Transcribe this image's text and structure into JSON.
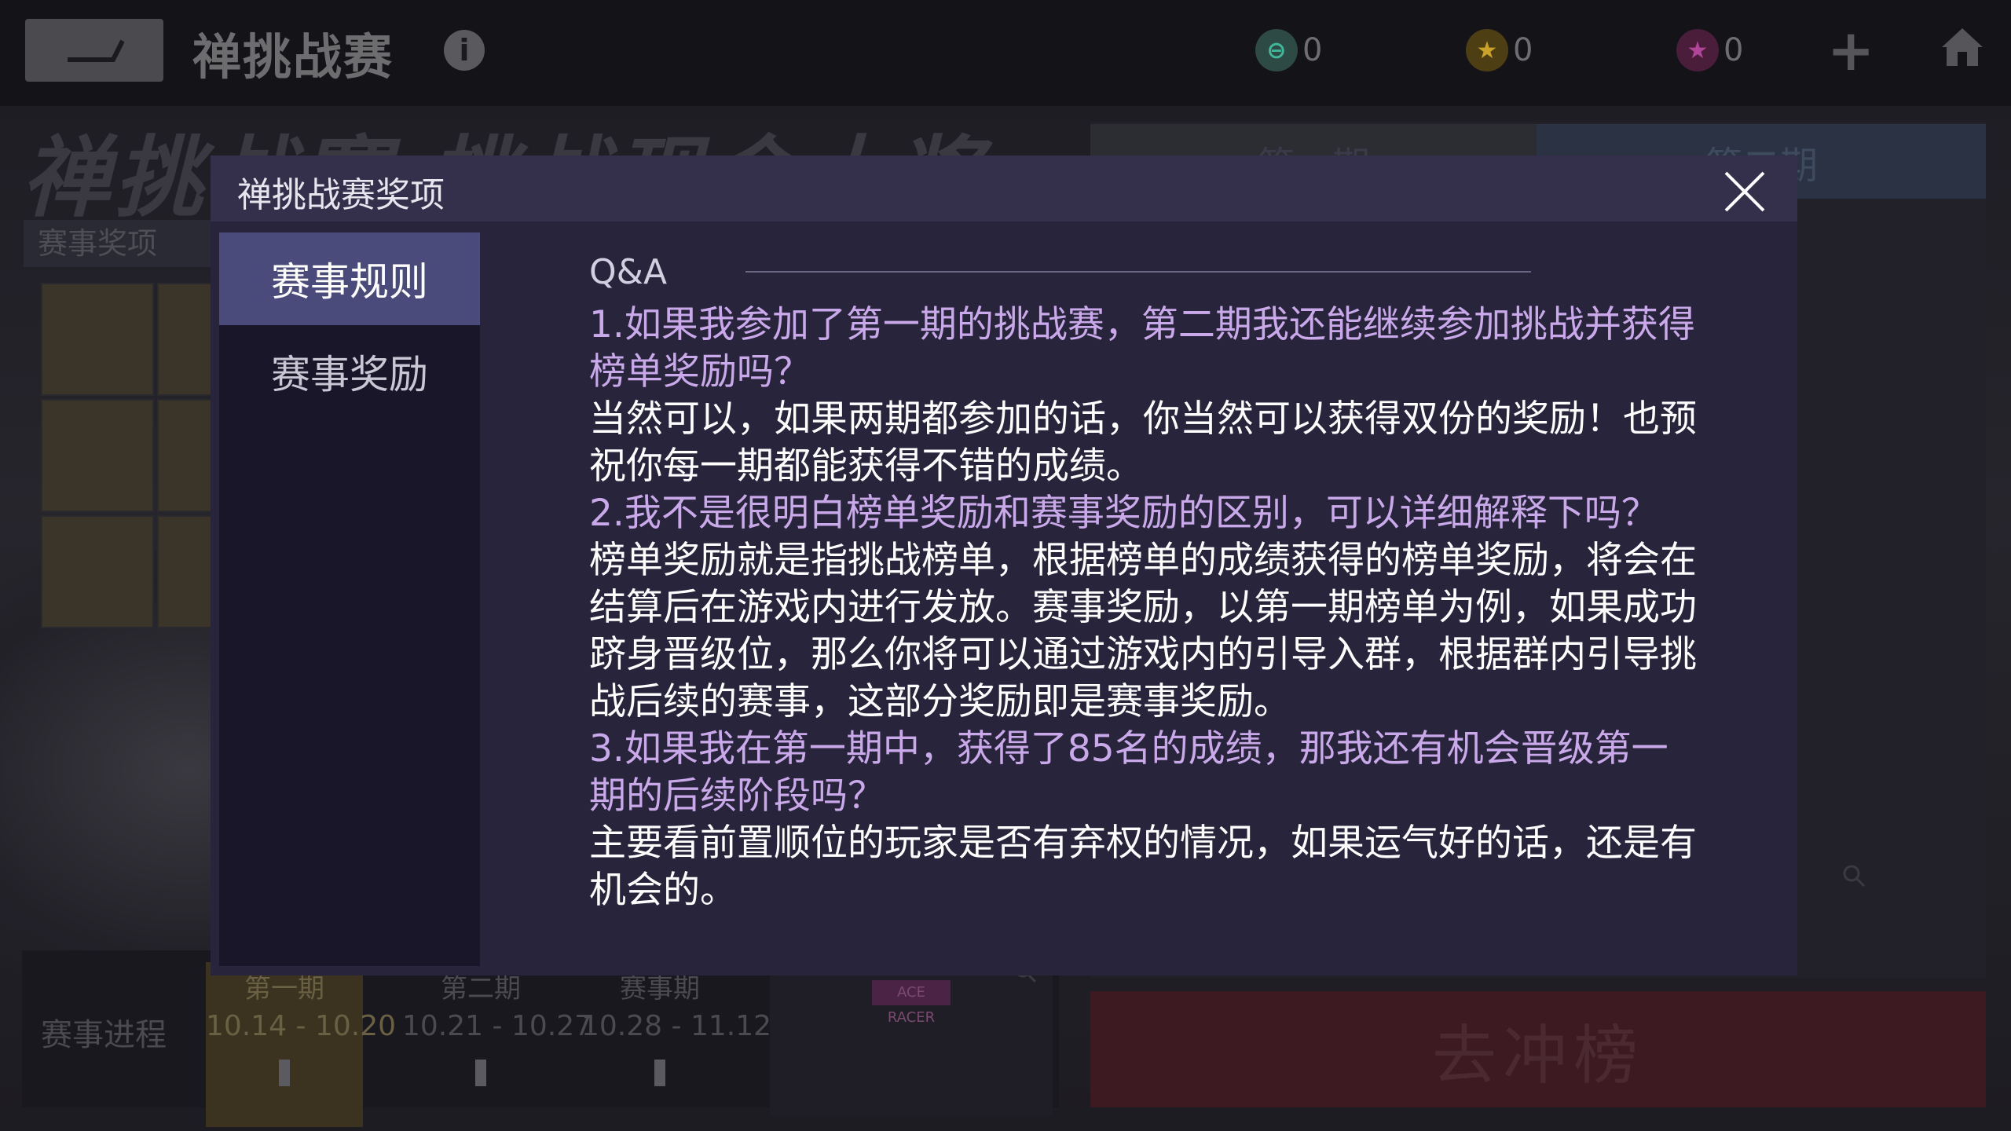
{
  "background": {
    "page_title": "禅挑战赛",
    "banner_text": "禅挑战赛 挑战现金大奖",
    "awards_label": "赛事奖项",
    "period_tabs": [
      "第一期",
      "第二期"
    ],
    "currencies": [
      {
        "icon": "ticket-icon",
        "value": "0",
        "color": "#3a8f7a"
      },
      {
        "icon": "gold-star-coin-icon",
        "value": "0",
        "color": "#b38a1e"
      },
      {
        "icon": "purple-star-coin-icon",
        "value": "0",
        "color": "#8a2e6a"
      }
    ],
    "progress": {
      "label": "赛事进程",
      "stages": [
        {
          "name": "第一期",
          "dates": "10.14 - 10.20",
          "active": true
        },
        {
          "name": "第二期",
          "dates": "10.21 - 10.27",
          "active": false
        },
        {
          "name": "赛事期",
          "dates": "10.28 - 11.12",
          "active": false
        }
      ],
      "bracket_tag": "ACE RACER"
    },
    "rank_button": "去冲榜"
  },
  "modal": {
    "title": "禅挑战赛奖项",
    "nav": [
      {
        "label": "赛事规则",
        "active": true
      },
      {
        "label": "赛事奖励",
        "active": false
      }
    ],
    "qa_title": "Q&A",
    "qa": [
      {
        "q": "1.如果我参加了第一期的挑战赛，第二期我还能继续参加挑战并获得榜单奖励吗？",
        "a": "当然可以，如果两期都参加的话，你当然可以获得双份的奖励！也预祝你每一期都能获得不错的成绩。"
      },
      {
        "q": "2.我不是很明白榜单奖励和赛事奖励的区别，可以详细解释下吗？",
        "a": "榜单奖励就是指挑战榜单，根据榜单的成绩获得的榜单奖励，将会在结算后在游戏内进行发放。赛事奖励，以第一期榜单为例，如果成功跻身晋级位，那么你将可以通过游戏内的引导入群，根据群内引导挑战后续的赛事，这部分奖励即是赛事奖励。"
      },
      {
        "q": "3.如果我在第一期中，获得了85名的成绩，那我还有机会晋级第一期的后续阶段吗？",
        "a": "主要看前置顺位的玩家是否有弃权的情况，如果运气好的话，还是有机会的。"
      }
    ]
  }
}
